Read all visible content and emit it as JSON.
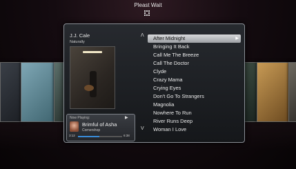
{
  "status": {
    "title": "Pleast Wait"
  },
  "album": {
    "artist": "J.J. Cale",
    "title": "Naturally"
  },
  "now_playing": {
    "label": "Now Playing:",
    "song": "Brimful of Asha",
    "artist": "Cornershop",
    "elapsed": "3:12",
    "total": "6:38",
    "progress": 0.48
  },
  "track_list": {
    "selected_index": 0,
    "tracks": [
      "After Midnight",
      "Bringing It Back",
      "Call Me The Breeze",
      "Call The Doctor",
      "Clyde",
      "Crazy Mama",
      "Crying Eyes",
      "Don't Go To Strangers",
      "Magnolia",
      "Nowhere To Run",
      "River Runs Deep",
      "Woman I Love"
    ]
  }
}
